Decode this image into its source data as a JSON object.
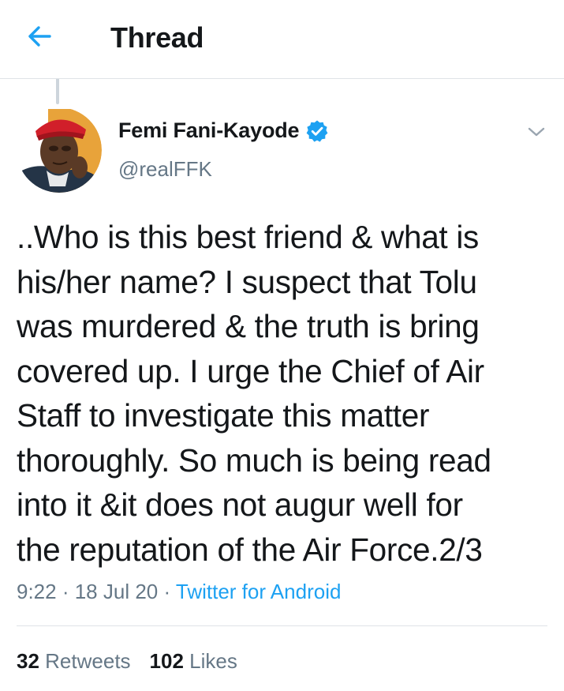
{
  "header": {
    "title": "Thread",
    "back_icon": "arrow-left-icon"
  },
  "colors": {
    "accent": "#1da1f2",
    "text_primary": "#14171a",
    "text_secondary": "#657786",
    "divider": "#dfe3e7"
  },
  "tweet": {
    "author": {
      "name": "Femi Fani-Kayode",
      "handle": "@realFFK",
      "verified": true
    },
    "text": "..Who is this best friend & what is\nhis/her name? I suspect that Tolu\nwas murdered & the truth is bring\ncovered up. I urge the Chief of Air\nStaff to investigate this matter\nthoroughly. So much is being read\ninto it &it does not augur well for\nthe reputation of the Air Force.2/3",
    "time": "9:22",
    "date": "18 Jul 20",
    "separator": " · ",
    "source": "Twitter for Android",
    "stats": {
      "retweets_count": "32",
      "retweets_label": "Retweets",
      "likes_count": "102",
      "likes_label": "Likes"
    }
  }
}
